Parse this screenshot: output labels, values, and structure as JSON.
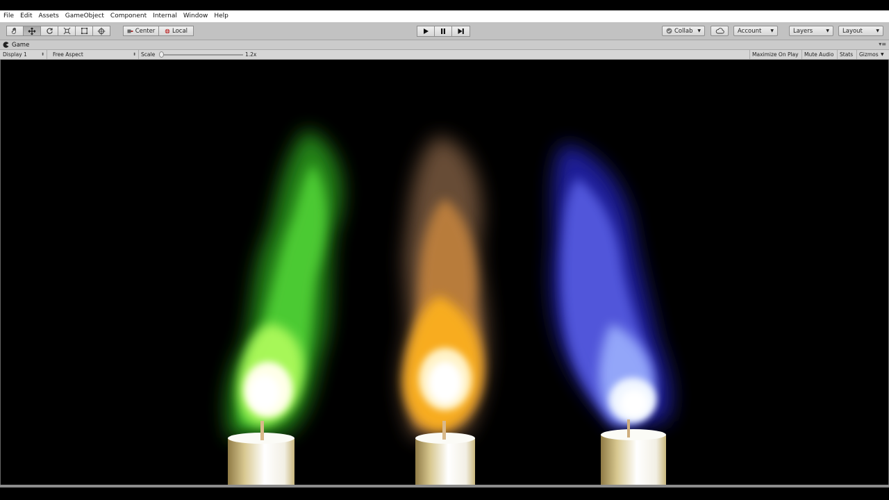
{
  "menu": [
    "File",
    "Edit",
    "Assets",
    "GameObject",
    "Component",
    "Internal",
    "Window",
    "Help"
  ],
  "toolbar": {
    "tools": [
      "hand-icon",
      "move-icon",
      "rotate-icon",
      "scale-icon",
      "rect-icon",
      "transform-icon"
    ],
    "pivot": "Center",
    "space": "Local",
    "collab": "Collab",
    "account": "Account",
    "layers": "Layers",
    "layout": "Layout"
  },
  "tab": {
    "title": "Game"
  },
  "gamebar": {
    "display": "Display 1",
    "aspect": "Free Aspect",
    "scale_label": "Scale",
    "scale_value": "1.2x",
    "maximize": "Maximize On Play",
    "mute": "Mute Audio",
    "stats": "Stats",
    "gizmos": "Gizmos"
  },
  "scene": {
    "candles": [
      {
        "flame_color": "green",
        "smoke": "#39c224",
        "glow": "#c9ff7a"
      },
      {
        "flame_color": "orange",
        "smoke": "#9a6a45",
        "glow": "#ffc02a"
      },
      {
        "flame_color": "blue",
        "smoke": "#3b3fd6",
        "glow": "#bcd2ff"
      }
    ]
  }
}
